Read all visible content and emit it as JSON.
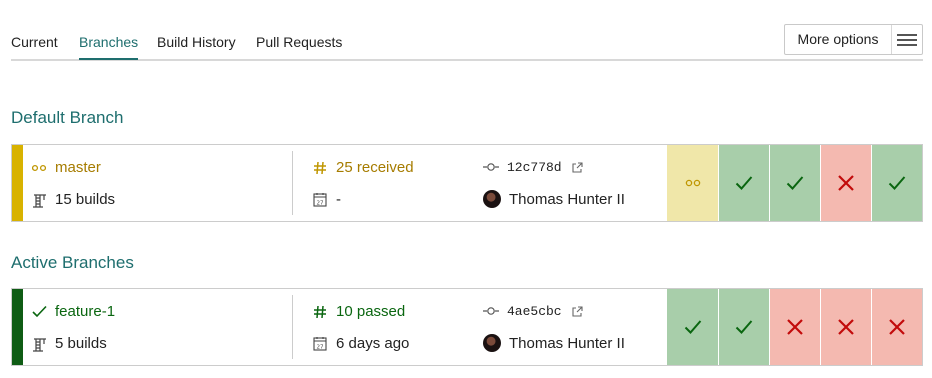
{
  "colors": {
    "teal": "#1e6e6e",
    "pending": "#bf9600",
    "passed": "#0a6610",
    "failed": "#c20b0b"
  },
  "tabs": [
    {
      "label": "Current",
      "active": false
    },
    {
      "label": "Branches",
      "active": true
    },
    {
      "label": "Build History",
      "active": false
    },
    {
      "label": "Pull Requests",
      "active": false
    }
  ],
  "more_options": {
    "label": "More options",
    "icon": "hamburger-icon"
  },
  "default_section": {
    "title": "Default Branch"
  },
  "active_section": {
    "title": "Active Branches"
  },
  "default_branch": {
    "state": "pending",
    "name": "master",
    "builds": "15 builds",
    "number": "25 received",
    "date": "-",
    "commit": "12c778d",
    "author": "Thomas Hunter II",
    "history": [
      "pending",
      "passed",
      "passed",
      "failed",
      "passed"
    ]
  },
  "feature_branch": {
    "state": "passed",
    "name": "feature-1",
    "builds": "5 builds",
    "number": "10 passed",
    "date": "6 days ago",
    "commit": "4ae5cbc",
    "author": "Thomas Hunter II",
    "history": [
      "passed",
      "passed",
      "failed",
      "failed",
      "failed"
    ]
  }
}
